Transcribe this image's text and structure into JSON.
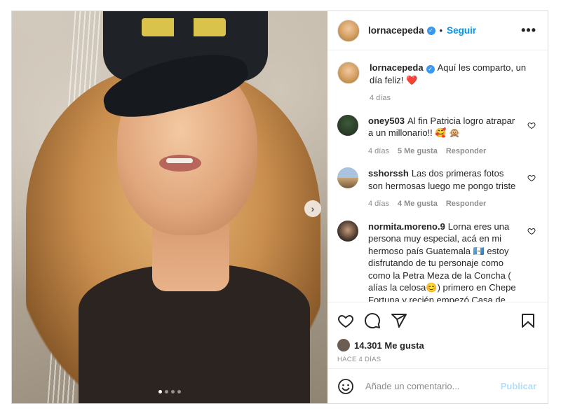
{
  "post": {
    "author": "lornacepeda",
    "separator": "•",
    "follow_label": "Seguir",
    "more_label": "•••",
    "caption": {
      "user": "lornacepeda",
      "text": "Aquí les comparto, un día feliz! ❤️",
      "time": "4 días"
    },
    "comments": [
      {
        "user": "oney503",
        "text": "Al fin Patricia logro atrapar a un millonario!! 🥰 🙊",
        "time": "4 días",
        "likes": "5 Me gusta",
        "reply": "Responder"
      },
      {
        "user": "sshorssh",
        "text": "Las dos primeras fotos son hermosas luego me pongo triste",
        "time": "4 días",
        "likes": "4 Me gusta",
        "reply": "Responder"
      },
      {
        "user": "normita.moreno.9",
        "text": "Lorna eres una persona muy especial, acá en mi hermoso país Guatemala 🇬🇹 estoy disfrutando de tu personaje como como la Petra Meza de la Concha ( alías la celosa😊) primero en Chepe Fortuna y recién empezó Casa de",
        "time": "",
        "likes": "",
        "reply": ""
      }
    ],
    "likes_count": "14.301 Me gusta",
    "posted_ago": "HACE 4 DÍAS",
    "add_comment_placeholder": "Añade un comentario...",
    "publish_label": "Publicar",
    "carousel": {
      "slides": 4,
      "active": 1,
      "next_label": "›"
    }
  },
  "colors": {
    "link": "#0095f6",
    "verified": "#3897f0",
    "heart": "#ed4956",
    "publish_disabled": "#b2dffc"
  },
  "icons": {
    "like": "heart-icon",
    "comment": "comment-icon",
    "share": "send-icon",
    "save": "bookmark-icon",
    "emoji": "smiley-icon",
    "verified": "verified-badge-icon",
    "more": "more-options-icon"
  }
}
